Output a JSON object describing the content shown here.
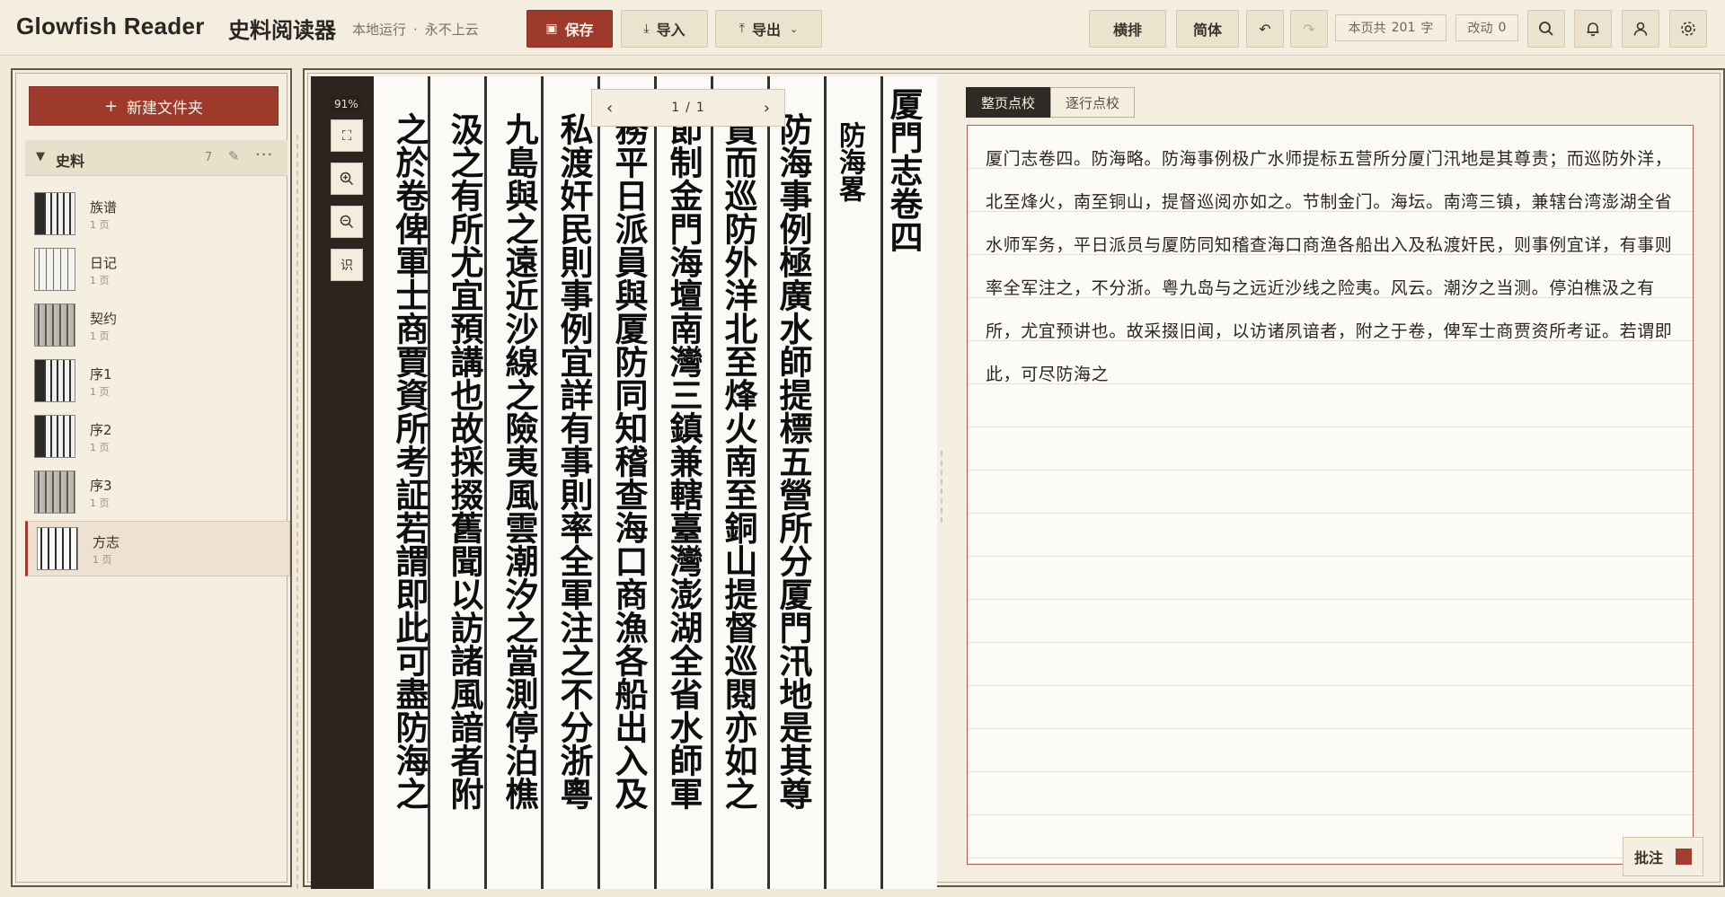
{
  "header": {
    "brand": "Glowfish Reader",
    "brand_cn": "史料阅读器",
    "tagline_left": "本地运行",
    "tagline_sep": "·",
    "tagline_right": "永不上云",
    "save_label": "保存",
    "import_label": "导入",
    "export_label": "导出",
    "horizontal_label": "横排",
    "simplified_label": "简体",
    "page_count_prefix": "本页共",
    "page_count_value": "201",
    "page_count_suffix": "字",
    "changes_label": "改动",
    "changes_value": "0"
  },
  "sidebar": {
    "new_folder_label": "新建文件夹",
    "folder": {
      "name": "史料",
      "count": "7",
      "items": [
        {
          "name": "族谱",
          "pages": "1 页"
        },
        {
          "name": "日记",
          "pages": "1 页"
        },
        {
          "name": "契约",
          "pages": "1 页"
        },
        {
          "name": "序1",
          "pages": "1 页"
        },
        {
          "name": "序2",
          "pages": "1 页"
        },
        {
          "name": "序3",
          "pages": "1 页"
        },
        {
          "name": "方志",
          "pages": "1 页"
        }
      ]
    }
  },
  "viewer": {
    "zoom": "91%",
    "ocr_label": "识",
    "page_current": "1",
    "page_sep": "/",
    "page_total": "1",
    "columns": [
      "厦門志卷四",
      "防海畧",
      "防海事例極廣水師提標五營所分厦門汛地是其尊",
      "責而巡防外洋北至烽火南至銅山提督巡閱亦如之",
      "節制金門海壇南灣三鎮兼轄臺灣澎湖全省水師軍",
      "務平日派員與厦防同知稽查海口商漁各船出入及",
      "私渡奸民則事例宜詳有事則率全軍注之不分浙粵",
      "九島與之遠近沙線之險夷風雲潮汐之當測停泊樵",
      "汲之有所尤宜預講也故採掇舊聞以訪諸風諳者附",
      "之於卷俾軍士商賈資所考証若謂即此可盡防海之"
    ]
  },
  "editor": {
    "tab_page": "整页点校",
    "tab_line": "逐行点校",
    "text": "厦门志卷四。防海略。防海事例极广水师提标五营所分厦门汛地是其尊责；而巡防外洋，北至烽火，南至铜山，提督巡阅亦如之。节制金门。海坛。南湾三镇，兼辖台湾澎湖全省水师军务，平日派员与厦防同知稽查海口商渔各船出入及私渡奸民，则事例宜详，有事则率全军注之，不分浙。粤九岛与之远近沙线之险夷。风云。潮汐之当测。停泊樵汲之有所，尤宜预讲也。故采掇旧闻，以访诸夙谙者，附之于卷，俾军士商贾资所考证。若谓即此，可尽防海之",
    "annotate_label": "批注"
  },
  "colors": {
    "accent": "#9e3a2c",
    "background": "#f1ead9",
    "editor_border": "#b95a4e"
  }
}
